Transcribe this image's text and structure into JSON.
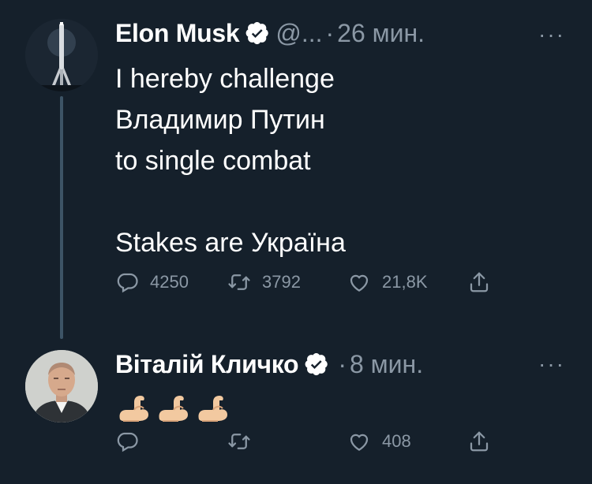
{
  "tweets": [
    {
      "author": "Elon Musk",
      "handle": "@...",
      "time": "26 мин.",
      "text": "I hereby challenge\nВладимир Путин\nto single combat\n\nStakes are Україна",
      "replies": "4250",
      "retweets": "3792",
      "likes": "21,8K"
    },
    {
      "author": "Віталій Кличко",
      "time": "8 мин.",
      "emoji": [
        "flexed-biceps",
        "flexed-biceps",
        "flexed-biceps"
      ],
      "likes": "408"
    }
  ],
  "colors": {
    "background": "#15202b",
    "text": "#ffffff",
    "muted": "#8b98a5",
    "thread_line": "#3d5466"
  }
}
